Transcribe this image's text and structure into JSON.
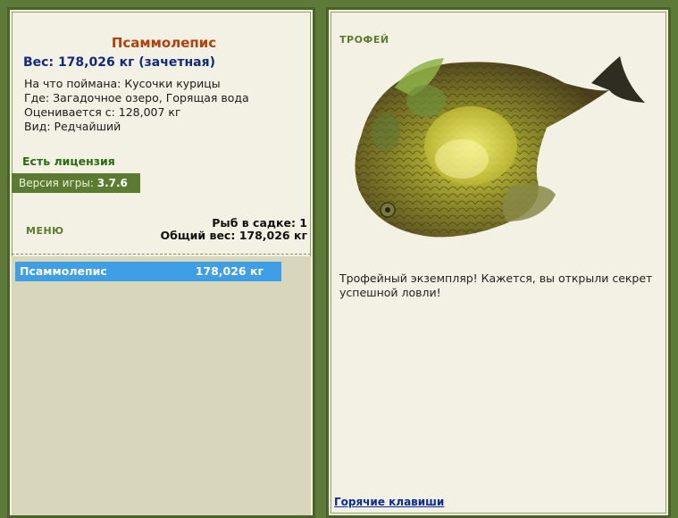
{
  "fish": {
    "name": "Псаммолепис",
    "weight_line": "Вес: 178,026 кг (зачетная)",
    "caught_on": "На что поймана: Кусочки курицы",
    "location": "Где: Загадочное озеро, Горящая вода",
    "valued_from": "Оценивается с: 128,007 кг",
    "kind": "Вид: Редчайший"
  },
  "license": "Есть лицензия",
  "version": {
    "label": "Версия игры:",
    "value": "3.7.6"
  },
  "menu_label": "МЕНЮ",
  "keep_net": {
    "count_line": "Рыб в садке: 1",
    "total_line": "Общий вес: 178,026 кг"
  },
  "catch_list": [
    {
      "name": "Псаммолепис",
      "weight": "178,026 кг"
    }
  ],
  "trophy": {
    "label": "ТРОФЕЙ",
    "description": "Трофейный экземпляр! Кажется, вы открыли секрет успешной ловли!"
  },
  "hotkeys_link": "Горячие клавиши",
  "colors": {
    "background": "#5e7a38",
    "panel": "#f2f1e4",
    "title": "#b4400c",
    "weight": "#122a7e",
    "license": "#2a6b14",
    "selected_row": "#3e9ee6",
    "link": "#0a2b9e"
  }
}
